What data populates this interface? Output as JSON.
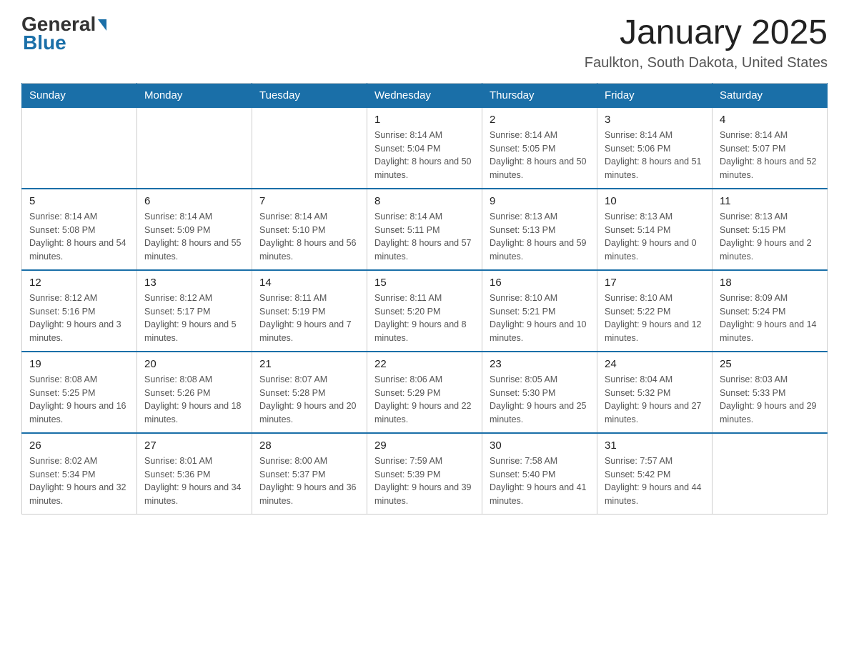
{
  "header": {
    "logo_general": "General",
    "logo_blue": "Blue",
    "month_title": "January 2025",
    "location": "Faulkton, South Dakota, United States"
  },
  "days_of_week": [
    "Sunday",
    "Monday",
    "Tuesday",
    "Wednesday",
    "Thursday",
    "Friday",
    "Saturday"
  ],
  "weeks": [
    [
      {
        "day": "",
        "info": ""
      },
      {
        "day": "",
        "info": ""
      },
      {
        "day": "",
        "info": ""
      },
      {
        "day": "1",
        "info": "Sunrise: 8:14 AM\nSunset: 5:04 PM\nDaylight: 8 hours\nand 50 minutes."
      },
      {
        "day": "2",
        "info": "Sunrise: 8:14 AM\nSunset: 5:05 PM\nDaylight: 8 hours\nand 50 minutes."
      },
      {
        "day": "3",
        "info": "Sunrise: 8:14 AM\nSunset: 5:06 PM\nDaylight: 8 hours\nand 51 minutes."
      },
      {
        "day": "4",
        "info": "Sunrise: 8:14 AM\nSunset: 5:07 PM\nDaylight: 8 hours\nand 52 minutes."
      }
    ],
    [
      {
        "day": "5",
        "info": "Sunrise: 8:14 AM\nSunset: 5:08 PM\nDaylight: 8 hours\nand 54 minutes."
      },
      {
        "day": "6",
        "info": "Sunrise: 8:14 AM\nSunset: 5:09 PM\nDaylight: 8 hours\nand 55 minutes."
      },
      {
        "day": "7",
        "info": "Sunrise: 8:14 AM\nSunset: 5:10 PM\nDaylight: 8 hours\nand 56 minutes."
      },
      {
        "day": "8",
        "info": "Sunrise: 8:14 AM\nSunset: 5:11 PM\nDaylight: 8 hours\nand 57 minutes."
      },
      {
        "day": "9",
        "info": "Sunrise: 8:13 AM\nSunset: 5:13 PM\nDaylight: 8 hours\nand 59 minutes."
      },
      {
        "day": "10",
        "info": "Sunrise: 8:13 AM\nSunset: 5:14 PM\nDaylight: 9 hours\nand 0 minutes."
      },
      {
        "day": "11",
        "info": "Sunrise: 8:13 AM\nSunset: 5:15 PM\nDaylight: 9 hours\nand 2 minutes."
      }
    ],
    [
      {
        "day": "12",
        "info": "Sunrise: 8:12 AM\nSunset: 5:16 PM\nDaylight: 9 hours\nand 3 minutes."
      },
      {
        "day": "13",
        "info": "Sunrise: 8:12 AM\nSunset: 5:17 PM\nDaylight: 9 hours\nand 5 minutes."
      },
      {
        "day": "14",
        "info": "Sunrise: 8:11 AM\nSunset: 5:19 PM\nDaylight: 9 hours\nand 7 minutes."
      },
      {
        "day": "15",
        "info": "Sunrise: 8:11 AM\nSunset: 5:20 PM\nDaylight: 9 hours\nand 8 minutes."
      },
      {
        "day": "16",
        "info": "Sunrise: 8:10 AM\nSunset: 5:21 PM\nDaylight: 9 hours\nand 10 minutes."
      },
      {
        "day": "17",
        "info": "Sunrise: 8:10 AM\nSunset: 5:22 PM\nDaylight: 9 hours\nand 12 minutes."
      },
      {
        "day": "18",
        "info": "Sunrise: 8:09 AM\nSunset: 5:24 PM\nDaylight: 9 hours\nand 14 minutes."
      }
    ],
    [
      {
        "day": "19",
        "info": "Sunrise: 8:08 AM\nSunset: 5:25 PM\nDaylight: 9 hours\nand 16 minutes."
      },
      {
        "day": "20",
        "info": "Sunrise: 8:08 AM\nSunset: 5:26 PM\nDaylight: 9 hours\nand 18 minutes."
      },
      {
        "day": "21",
        "info": "Sunrise: 8:07 AM\nSunset: 5:28 PM\nDaylight: 9 hours\nand 20 minutes."
      },
      {
        "day": "22",
        "info": "Sunrise: 8:06 AM\nSunset: 5:29 PM\nDaylight: 9 hours\nand 22 minutes."
      },
      {
        "day": "23",
        "info": "Sunrise: 8:05 AM\nSunset: 5:30 PM\nDaylight: 9 hours\nand 25 minutes."
      },
      {
        "day": "24",
        "info": "Sunrise: 8:04 AM\nSunset: 5:32 PM\nDaylight: 9 hours\nand 27 minutes."
      },
      {
        "day": "25",
        "info": "Sunrise: 8:03 AM\nSunset: 5:33 PM\nDaylight: 9 hours\nand 29 minutes."
      }
    ],
    [
      {
        "day": "26",
        "info": "Sunrise: 8:02 AM\nSunset: 5:34 PM\nDaylight: 9 hours\nand 32 minutes."
      },
      {
        "day": "27",
        "info": "Sunrise: 8:01 AM\nSunset: 5:36 PM\nDaylight: 9 hours\nand 34 minutes."
      },
      {
        "day": "28",
        "info": "Sunrise: 8:00 AM\nSunset: 5:37 PM\nDaylight: 9 hours\nand 36 minutes."
      },
      {
        "day": "29",
        "info": "Sunrise: 7:59 AM\nSunset: 5:39 PM\nDaylight: 9 hours\nand 39 minutes."
      },
      {
        "day": "30",
        "info": "Sunrise: 7:58 AM\nSunset: 5:40 PM\nDaylight: 9 hours\nand 41 minutes."
      },
      {
        "day": "31",
        "info": "Sunrise: 7:57 AM\nSunset: 5:42 PM\nDaylight: 9 hours\nand 44 minutes."
      },
      {
        "day": "",
        "info": ""
      }
    ]
  ]
}
